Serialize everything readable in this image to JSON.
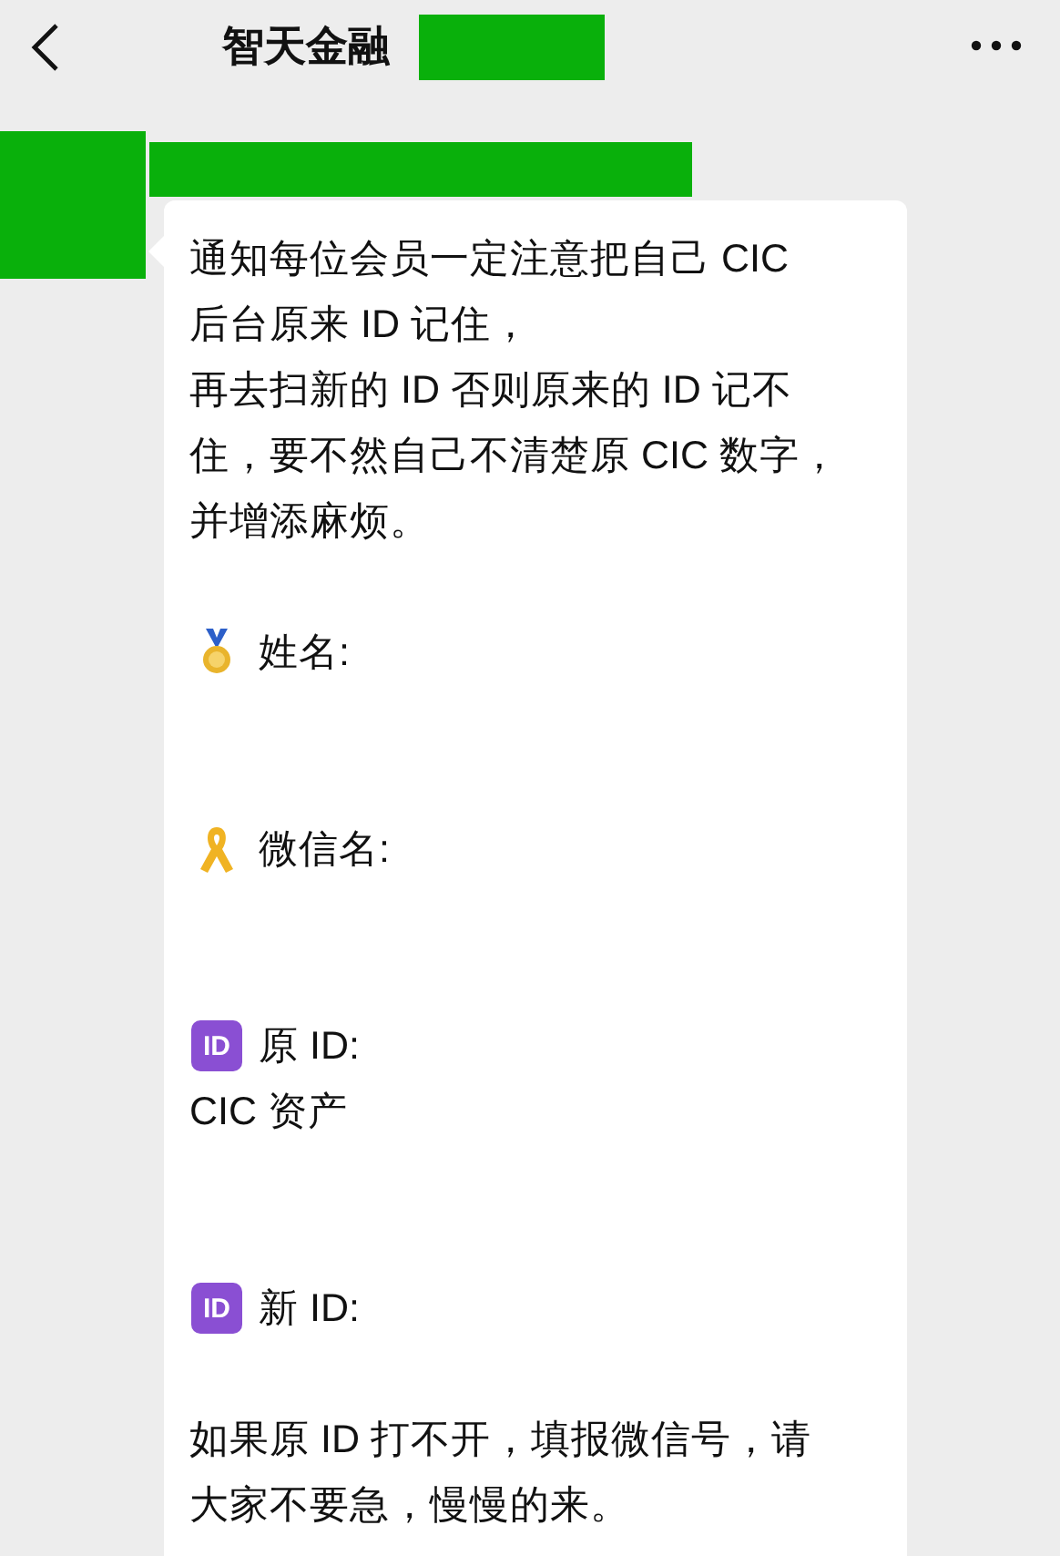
{
  "header": {
    "title": "智天金融"
  },
  "message": {
    "blocks": [
      {
        "kind": "notice",
        "lines": [
          "通知每位会员一定注意把自己 CIC",
          "后台原来 ID 记住，",
          "再去扫新的 ID 否则原来的 ID 记不",
          "住，要不然自己不清楚原 CIC 数字，",
          "并增添麻烦。"
        ]
      },
      {
        "kind": "medal",
        "label": "姓名:"
      },
      {
        "kind": "ribbon",
        "label": "微信名:"
      },
      {
        "kind": "id",
        "icon_text": "ID",
        "label": "原 ID:",
        "value": "CIC 资产"
      },
      {
        "kind": "id",
        "icon_text": "ID",
        "label": "新 ID:"
      },
      {
        "kind": "notice",
        "lines": [
          "如果原 ID 打不开，填报微信号，请",
          "大家不要急，慢慢的来。"
        ]
      }
    ]
  }
}
